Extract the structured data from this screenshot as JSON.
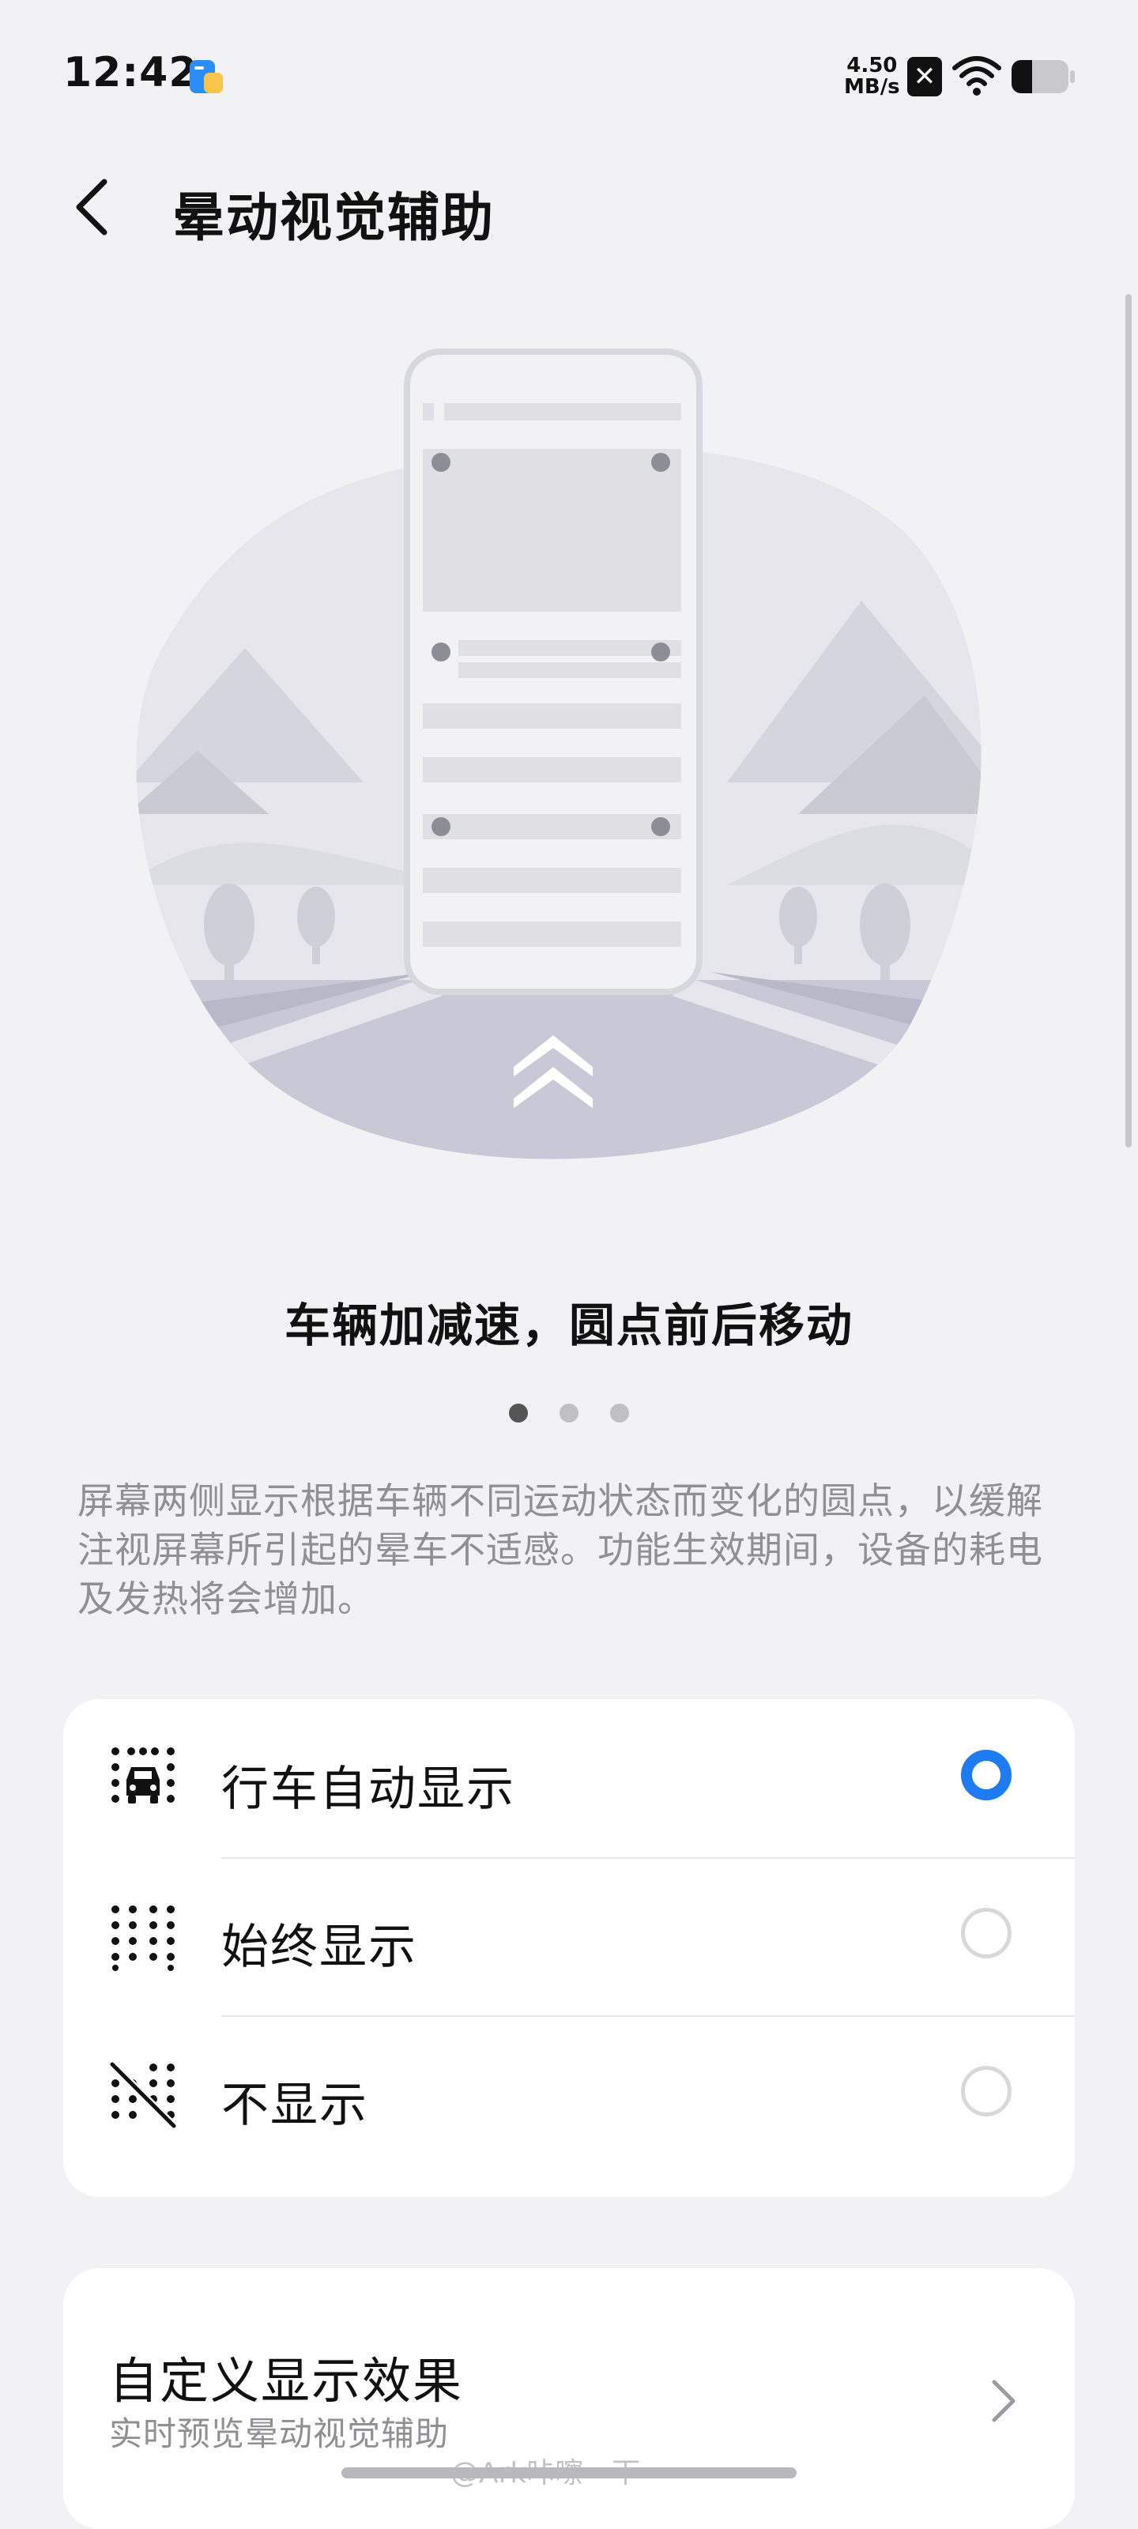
{
  "status_bar": {
    "time": "12:42",
    "speed_value": "4.50",
    "speed_unit": "MB/s",
    "badge": "✕",
    "icons": [
      "app-icon",
      "close-badge",
      "wifi-icon",
      "battery-icon"
    ]
  },
  "header": {
    "title": "晕动视觉辅助",
    "back_icon": "chevron-left-icon"
  },
  "illustration": {
    "caption": "车辆加减速，圆点前后移动"
  },
  "pager": {
    "total": 3,
    "active_index": 0
  },
  "description": "屏幕两侧显示根据车辆不同运动状态而变化的圆点，以缓解注视屏幕所引起的晕车不适感。功能生效期间，设备的耗电及发热将会增加。",
  "options": {
    "items": [
      {
        "label": "行车自动显示",
        "icon": "car-dots-icon",
        "selected": true
      },
      {
        "label": "始终显示",
        "icon": "dots-grid-icon",
        "selected": false
      },
      {
        "label": "不显示",
        "icon": "dots-off-icon",
        "selected": false
      }
    ]
  },
  "custom": {
    "title": "自定义显示效果",
    "subtitle": "实时预览晕动视觉辅助",
    "chevron": "chevron-right-icon"
  },
  "watermark": "@Ark咔嚓一下",
  "colors": {
    "accent": "#1f7cf0",
    "background": "#f2f2f4",
    "card": "#ffffff",
    "secondary_text": "#8f8f94"
  }
}
